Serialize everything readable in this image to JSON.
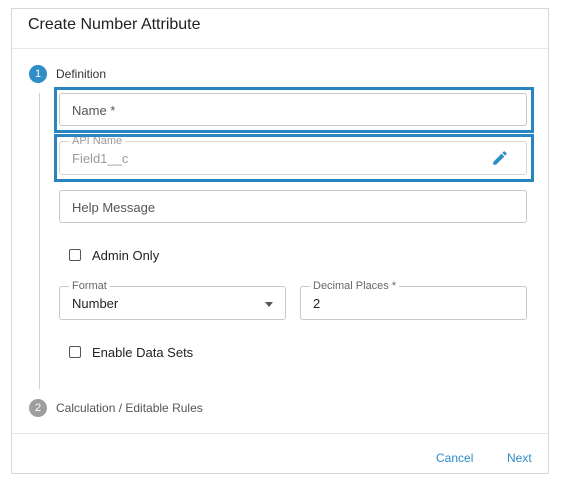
{
  "dialog": {
    "title": "Create Number Attribute"
  },
  "steps": [
    {
      "number": "1",
      "label": "Definition",
      "state": "active"
    },
    {
      "number": "2",
      "label": "Calculation / Editable Rules",
      "state": "inactive"
    }
  ],
  "form": {
    "name_placeholder": "Name *",
    "api_name_label": "API Name",
    "api_name_value": "Field1__c",
    "help_message_placeholder": "Help Message",
    "admin_only_label": "Admin Only",
    "format_label": "Format",
    "format_value": "Number",
    "decimal_places_label": "Decimal Places *",
    "decimal_places_value": "2",
    "enable_data_sets_label": "Enable Data Sets",
    "admin_only_checked": false,
    "enable_data_sets_checked": false
  },
  "footer": {
    "cancel_label": "Cancel",
    "next_label": "Next"
  },
  "colors": {
    "accent": "#2e8cc6",
    "highlight": "#2a84c0",
    "inactive_step": "#9e9e9e"
  },
  "icons": {
    "edit": "pencil-icon",
    "dropdown": "caret-down-icon"
  }
}
